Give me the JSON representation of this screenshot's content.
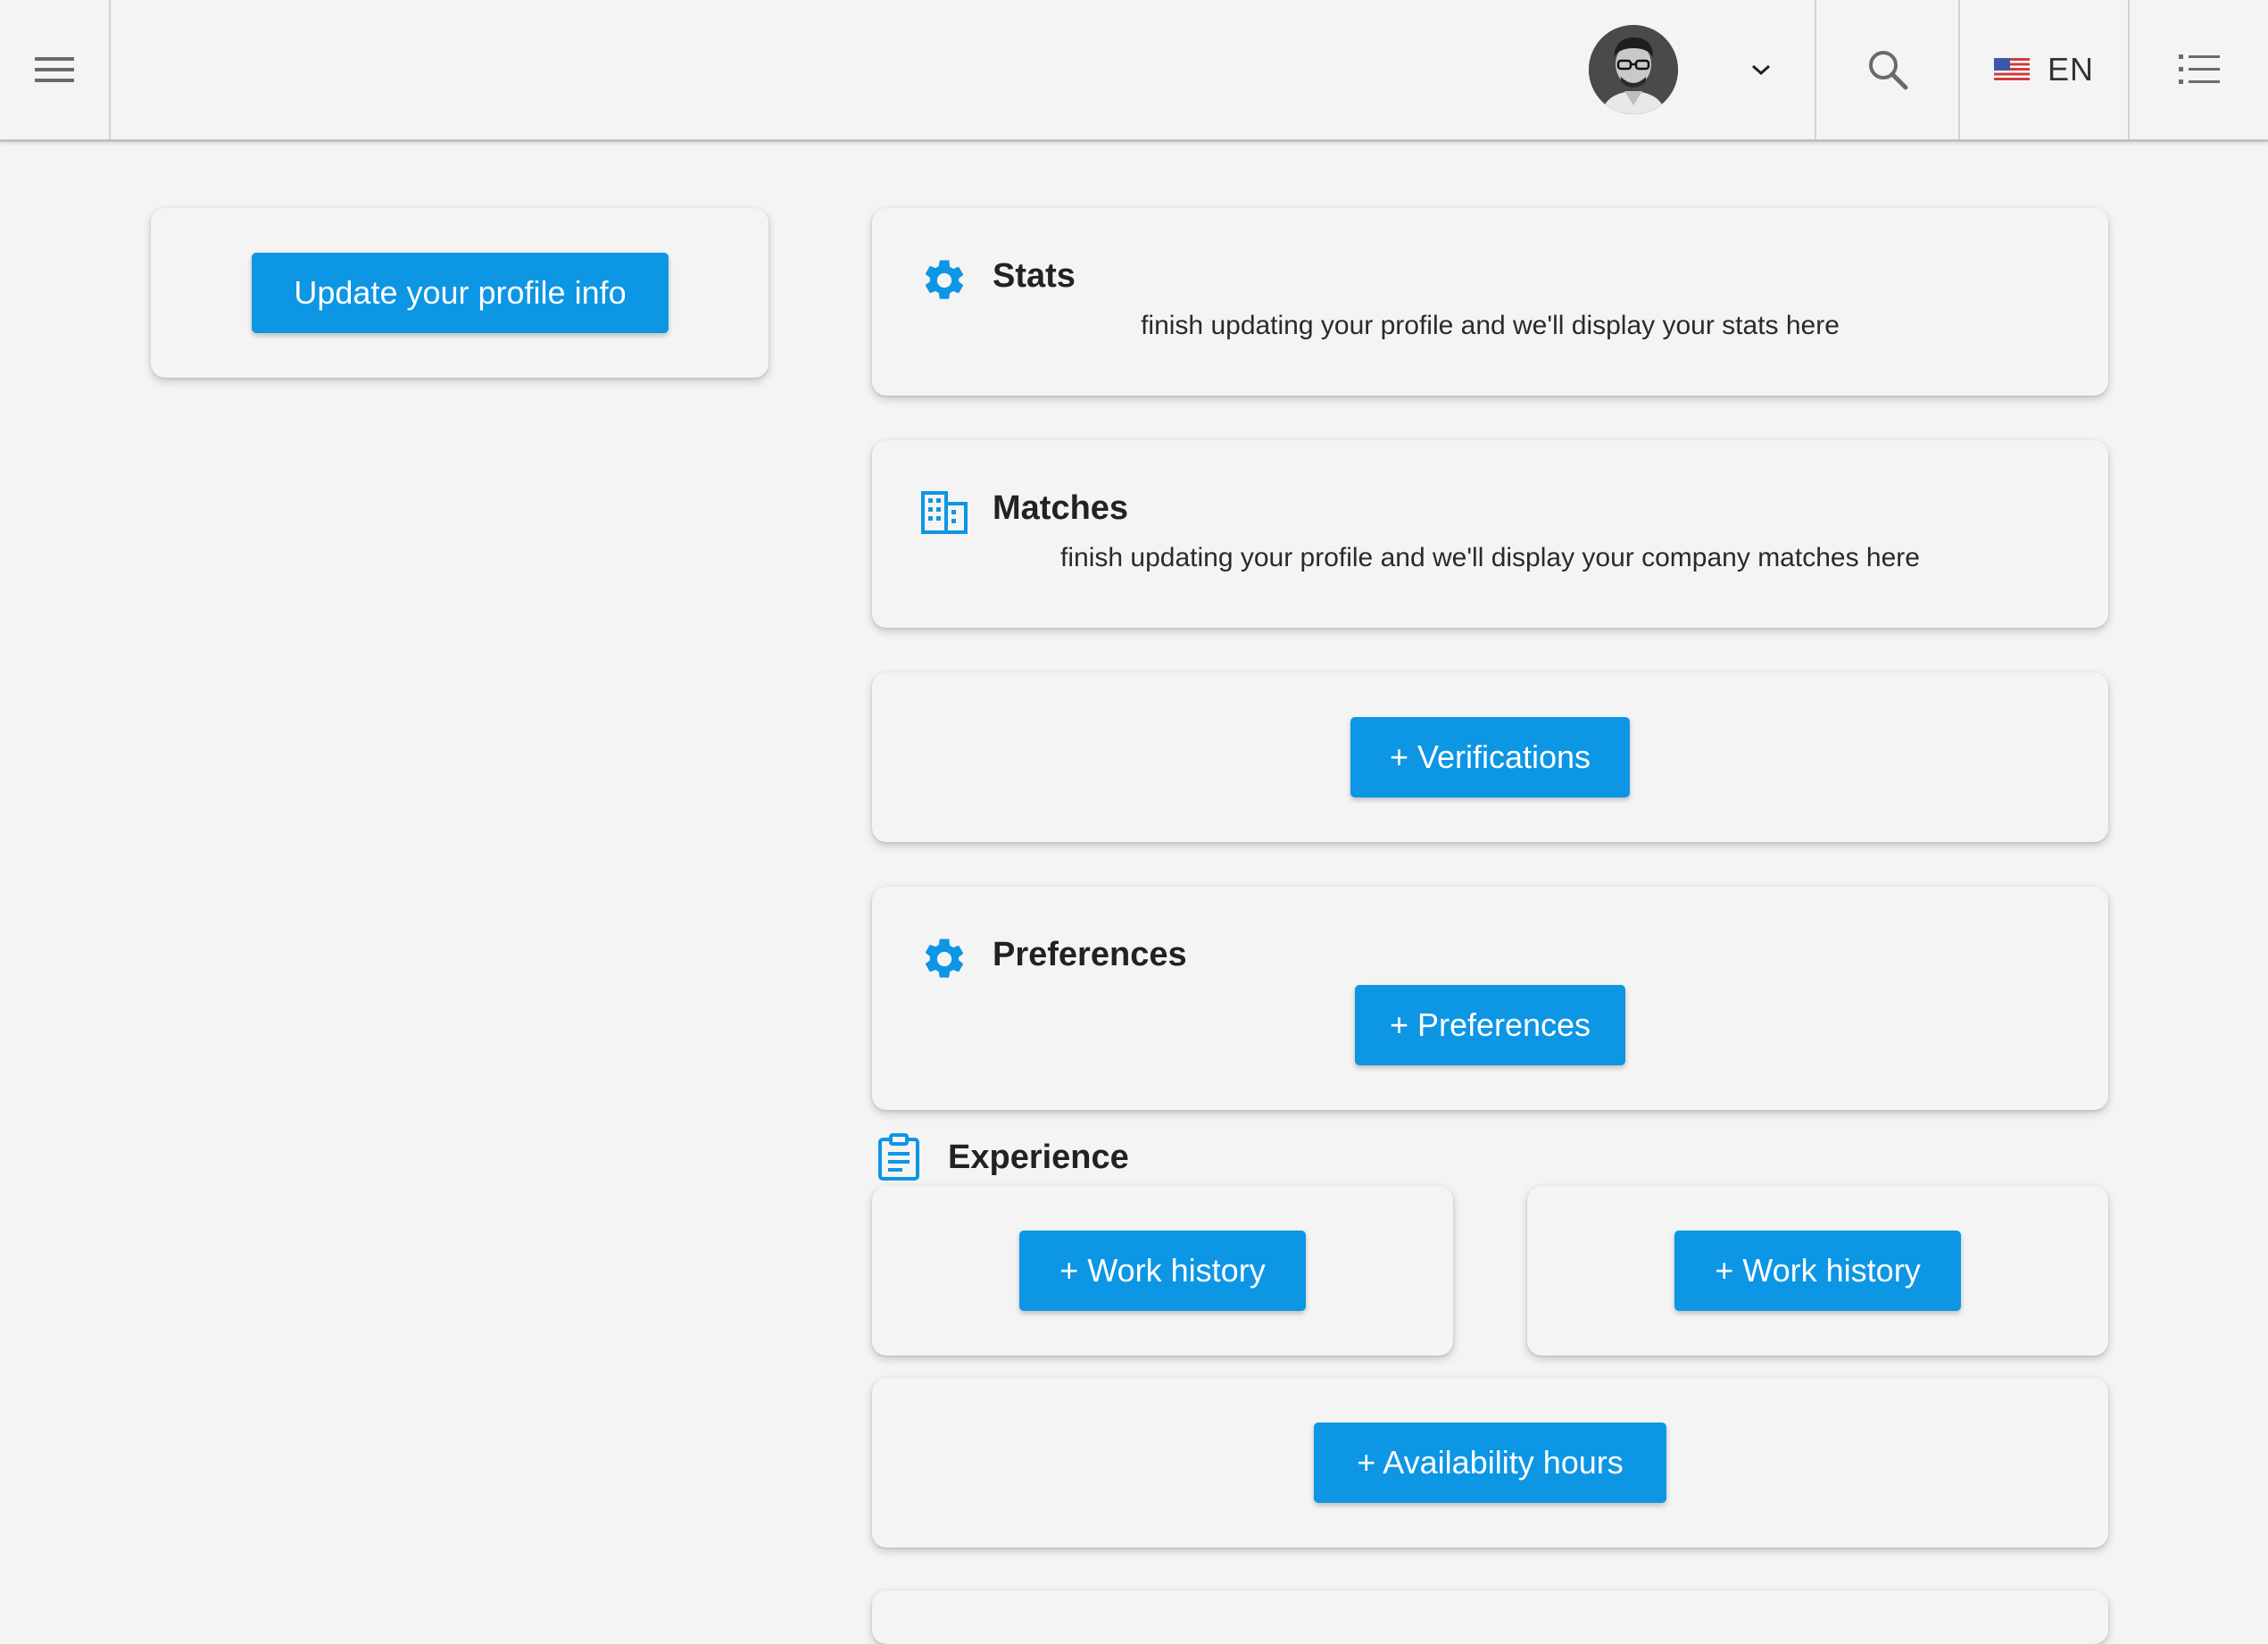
{
  "header": {
    "menu_icon": "hamburger-menu-icon",
    "avatar_icon": "user-avatar",
    "caret_icon": "chevron-down-icon",
    "search_icon": "search-icon",
    "language": {
      "flag_icon": "us-flag-icon",
      "label": "EN"
    },
    "list_icon": "list-icon"
  },
  "sidebar": {
    "update_profile_button": "Update your profile info"
  },
  "stats": {
    "icon": "gear-icon",
    "title": "Stats",
    "description": "finish updating your profile and we'll display your stats here"
  },
  "matches": {
    "icon": "building-icon",
    "title": "Matches",
    "description": "finish updating your profile and we'll display your company matches here"
  },
  "verifications": {
    "button": "+ Verifications"
  },
  "preferences": {
    "icon": "gear-icon",
    "title": "Preferences",
    "button": "+ Preferences"
  },
  "experience": {
    "icon": "clipboard-icon",
    "title": "Experience",
    "work_history_buttons": [
      "+ Work history",
      "+ Work history"
    ]
  },
  "availability": {
    "button": "+ Availability hours"
  },
  "colors": {
    "accent": "#0d96e4",
    "background": "#f4f4f4",
    "text": "#222222"
  }
}
